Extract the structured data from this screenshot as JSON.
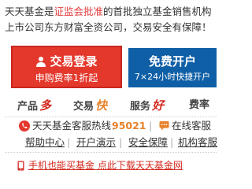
{
  "notice": {
    "line1_prefix": "天天基金是",
    "line1_highlight": "证监会批准",
    "line1_suffix": "的首批独立基金销售机构",
    "line2_prefix": "上市公司东方财富全资公司，交易安全有保障！"
  },
  "login": {
    "title": "交易登录",
    "subtitle": "申购费率1折起"
  },
  "open_account": {
    "title": "免费开户",
    "subtitle": "7×24小时快捷开户"
  },
  "tags": [
    {
      "label": "产品",
      "accent": "多"
    },
    {
      "label": "交易",
      "accent": "快"
    },
    {
      "label": "服务",
      "accent": "好"
    },
    {
      "label": "费率",
      "accent": ""
    }
  ],
  "hotline": {
    "label": "天天基金客服热线：",
    "number": "95021",
    "separator": "|",
    "service_label": "在线客服"
  },
  "links": [
    {
      "label": "帮助中心"
    },
    {
      "label": "开户演示"
    },
    {
      "label": "安全保障"
    },
    {
      "label": "机构客服"
    }
  ],
  "links_separator": "|",
  "promo": {
    "text": "手机也能买基金 点此下载天天基金网"
  },
  "colors": {
    "login_bg": "#e4382d",
    "open_bg": "#0f5fa6",
    "hotline_number": "#e8822a",
    "accent_red": "#d32a1f"
  }
}
